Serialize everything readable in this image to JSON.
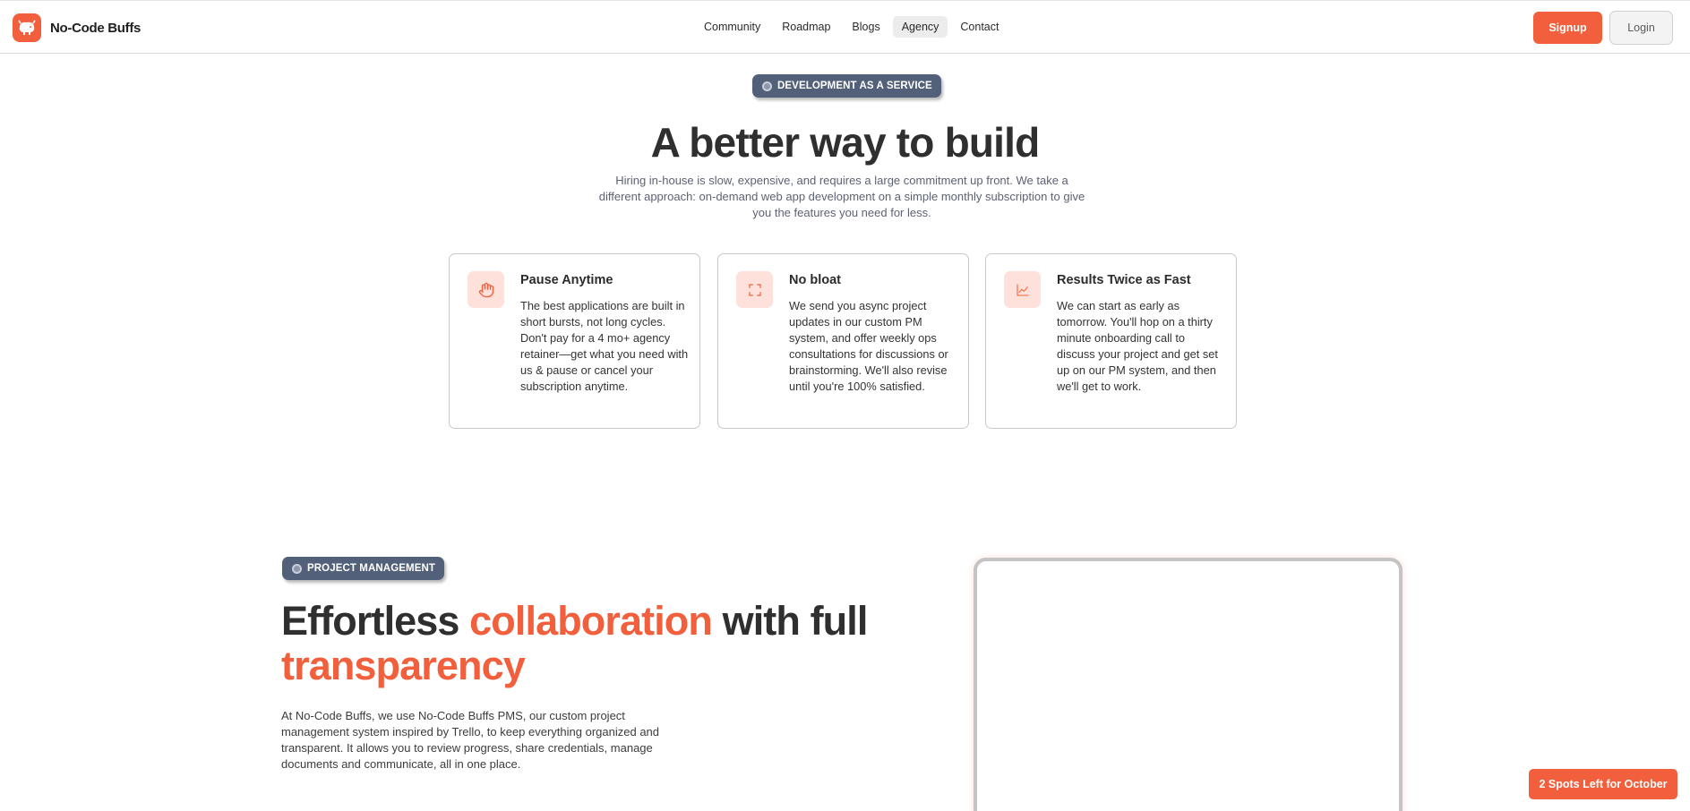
{
  "brand": {
    "name": "No-Code Buffs",
    "logo_icon": "buffalo-logo-icon"
  },
  "nav": {
    "items": [
      {
        "label": "Community"
      },
      {
        "label": "Roadmap"
      },
      {
        "label": "Blogs"
      },
      {
        "label": "Agency",
        "active": true
      },
      {
        "label": "Contact"
      }
    ]
  },
  "auth": {
    "signup_label": "Signup",
    "login_label": "Login"
  },
  "hero": {
    "badge": "DEVELOPMENT AS A SERVICE",
    "title": "A better way to build",
    "subtitle": "Hiring in-house is slow, expensive, and requires a large commitment up front. We take a different approach: on-demand web app development on a simple monthly subscription to give you the features you need for less."
  },
  "features": [
    {
      "icon": "hand-icon",
      "title": "Pause Anytime",
      "description": "The best applications are built in short bursts, not long cycles. Don't pay for a 4 mo+ agency retainer—get what you need with us & pause or cancel your subscription anytime."
    },
    {
      "icon": "expand-icon",
      "title": "No bloat",
      "description": "We send you async project updates in our custom PM system, and offer weekly ops consultations for discussions or brainstorming. We'll also revise until you're 100% satisfied."
    },
    {
      "icon": "chart-line-icon",
      "title": "Results Twice as Fast",
      "description": "We can start as early as tomorrow. You'll hop on a thirty minute onboarding call to discuss your project and get set up on our PM system, and then we'll get to work."
    }
  ],
  "project_management": {
    "badge": "PROJECT MANAGEMENT",
    "title_part1": "Effortless ",
    "title_highlight1": "collaboration",
    "title_part2": " with full ",
    "title_highlight2": "transparency",
    "description": "At No-Code Buffs, we use No-Code Buffs PMS, our custom project management system inspired by Trello, to keep everything organized and transparent. It allows you to review progress, share credentials, manage documents and communicate, all in one place."
  },
  "cta": {
    "spots_label": "2 Spots Left for October"
  },
  "colors": {
    "accent": "#f15f3c",
    "badge": "#526079",
    "icon_bg": "#fde1da"
  }
}
